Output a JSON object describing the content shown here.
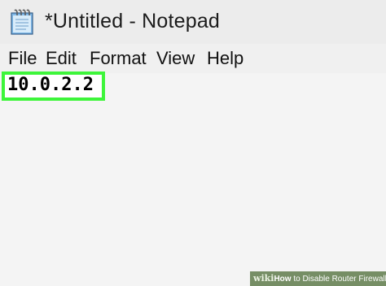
{
  "window": {
    "title": "*Untitled - Notepad",
    "icon": "notepad-icon"
  },
  "menu": {
    "items": [
      {
        "label": "File"
      },
      {
        "label": "Edit"
      },
      {
        "label": "Format"
      },
      {
        "label": "View"
      },
      {
        "label": "Help"
      }
    ]
  },
  "editor": {
    "text": "10.0.2.2",
    "highlight_color": "#3df53a"
  },
  "watermark": {
    "logo": "wiki",
    "bold": "How",
    "text": " to Disable Router Firewall"
  }
}
